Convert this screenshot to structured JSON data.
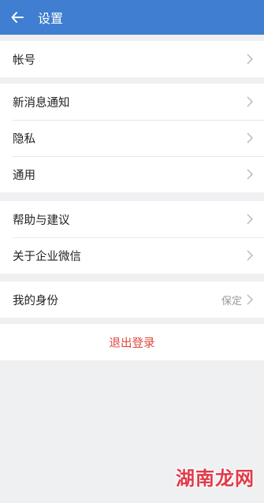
{
  "header": {
    "title": "设置",
    "back_icon": "arrow-left-icon",
    "color": "#3f7ed0"
  },
  "groups": [
    {
      "items": [
        {
          "label": "帐号"
        }
      ]
    },
    {
      "items": [
        {
          "label": "新消息通知"
        },
        {
          "label": "隐私"
        },
        {
          "label": "通用"
        }
      ]
    },
    {
      "items": [
        {
          "label": "帮助与建议"
        },
        {
          "label": "关于企业微信"
        }
      ]
    },
    {
      "items": [
        {
          "label": "我的身份",
          "value": "保定"
        }
      ]
    }
  ],
  "logout": {
    "label": "退出登录",
    "color": "#e0463c"
  },
  "watermark": {
    "text": "湖南龙网"
  }
}
